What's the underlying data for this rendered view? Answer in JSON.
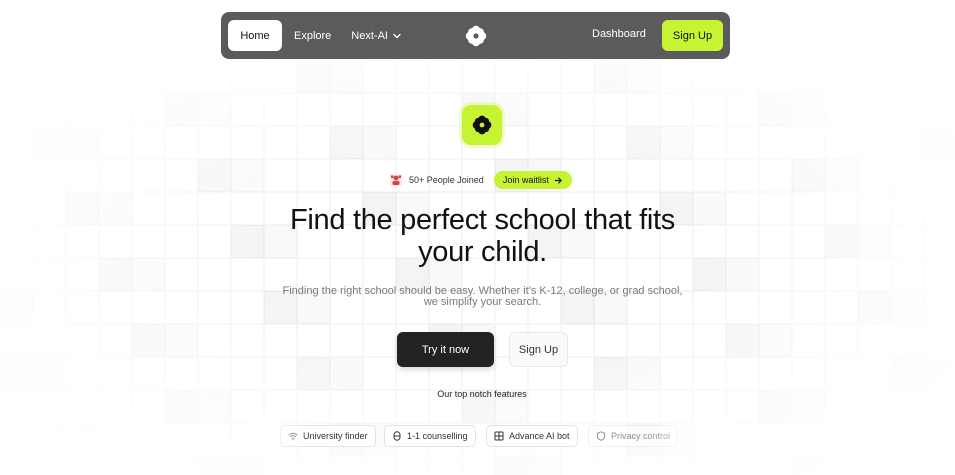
{
  "navbar": {
    "home": "Home",
    "explore": "Explore",
    "next_ai": "Next-AI",
    "dashboard": "Dashboard",
    "sign_up": "Sign Up"
  },
  "hero": {
    "joined_text": "50+ People Joined",
    "waitlist_label": "Join waitlist",
    "headline_line1": "Find the perfect school that fits",
    "headline_line2": "your child.",
    "subtext_line1": "Finding the right school should be easy. Whether it's K-12, college, or grad school,",
    "subtext_line2": "we simplify your search.",
    "try_label": "Try it now",
    "sign_up_label": "Sign Up"
  },
  "features": {
    "title": "Our top notch features",
    "items": [
      {
        "label": "University finder",
        "icon": "wifi-icon"
      },
      {
        "label": "1-1 counselling",
        "icon": "capsule-icon"
      },
      {
        "label": "Advance AI bot",
        "icon": "grid-icon"
      },
      {
        "label": "Privacy control",
        "icon": "shield-icon"
      }
    ]
  },
  "colors": {
    "accent": "#c6f432",
    "navbar": "#5b5b5b",
    "primary_button": "#222222"
  }
}
